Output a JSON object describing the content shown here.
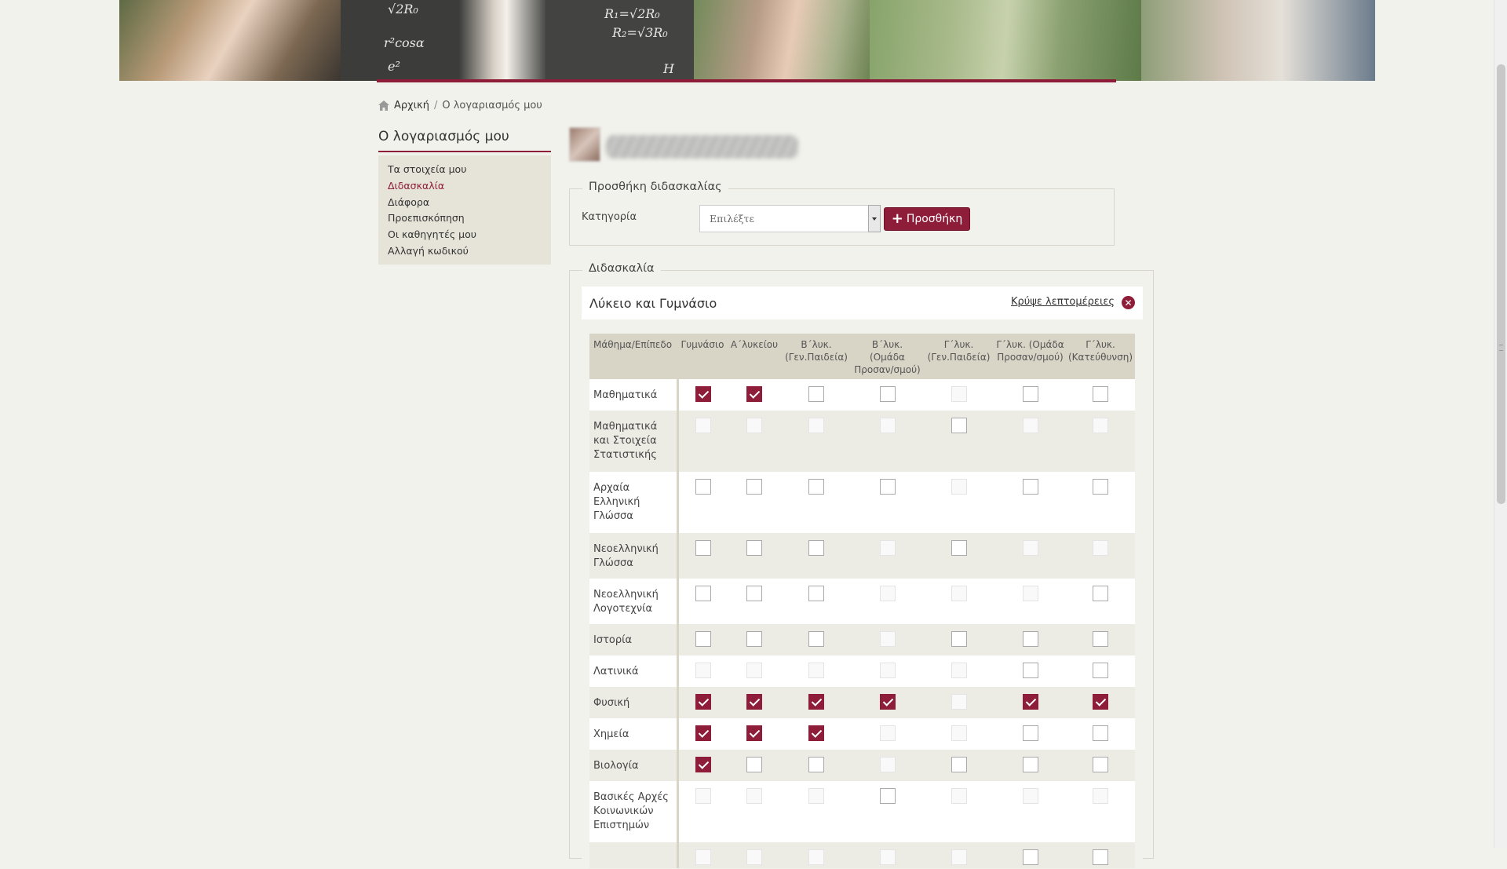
{
  "breadcrumb": {
    "home": "Αρχική",
    "current": "Ο λογαριασμός μου"
  },
  "sidebar": {
    "title": "Ο λογαριασμός μου",
    "items": [
      {
        "label": "Τα στοιχεία μου",
        "active": false
      },
      {
        "label": "Διδασκαλία",
        "active": true
      },
      {
        "label": "Διάφορα",
        "active": false
      },
      {
        "label": "Προεπισκόπηση",
        "active": false
      },
      {
        "label": "Οι καθηγητές μου",
        "active": false
      },
      {
        "label": "Αλλαγή κωδικού",
        "active": false
      }
    ]
  },
  "add_teaching": {
    "legend": "Προσθήκη διδασκαλίας",
    "category_label": "Κατηγορία",
    "select_value": "Επιλέξτε",
    "add_button": "Προσθήκη"
  },
  "teaching": {
    "legend": "Διδασκαλία",
    "card_title": "Λύκειο και Γυμνάσιο",
    "hide_details": "Κρύψε λεπτομέρειες",
    "columns": [
      "Μάθημα/Επίπεδο",
      "Γυμνάσιο",
      "Α΄λυκείου",
      "Β΄λυκ. (Γεν.Παιδεία)",
      "Β΄λυκ. (Ομάδα Προσαν/σμού)",
      "Γ΄λυκ. (Γεν.Παιδεία)",
      "Γ΄λυκ. (Ομάδα Προσαν/σμού)",
      "Γ΄λυκ. (Κατεύθυνση)"
    ],
    "rows": [
      {
        "subject": "Μαθηματικά",
        "cells": [
          "on",
          "on",
          "off",
          "off",
          "dis",
          "off",
          "off"
        ]
      },
      {
        "subject": "Μαθηματικά και Στοιχεία Στατιστικής",
        "cells": [
          "dis",
          "dis",
          "dis",
          "dis",
          "off",
          "dis",
          "dis"
        ]
      },
      {
        "subject": "Αρχαία Ελληνική Γλώσσα",
        "cells": [
          "off",
          "off",
          "off",
          "off",
          "dis",
          "off",
          "off"
        ]
      },
      {
        "subject": "Νεοελληνική Γλώσσα",
        "cells": [
          "off",
          "off",
          "off",
          "dis",
          "off",
          "dis",
          "dis"
        ]
      },
      {
        "subject": "Νεοελληνική Λογοτεχνία",
        "cells": [
          "off",
          "off",
          "off",
          "dis",
          "dis",
          "dis",
          "off"
        ]
      },
      {
        "subject": "Ιστορία",
        "cells": [
          "off",
          "off",
          "off",
          "dis",
          "off",
          "off",
          "off"
        ]
      },
      {
        "subject": "Λατινικά",
        "cells": [
          "dis",
          "dis",
          "dis",
          "dis",
          "dis",
          "off",
          "off"
        ]
      },
      {
        "subject": "Φυσική",
        "cells": [
          "on",
          "on",
          "on",
          "on",
          "dis",
          "on",
          "on"
        ]
      },
      {
        "subject": "Χημεία",
        "cells": [
          "on",
          "on",
          "on",
          "dis",
          "dis",
          "off",
          "off"
        ]
      },
      {
        "subject": "Βιολογία",
        "cells": [
          "on",
          "off",
          "off",
          "dis",
          "off",
          "off",
          "off"
        ]
      },
      {
        "subject": "Βασικές Αρχές Κοινωνικών Επιστημών",
        "cells": [
          "dis",
          "dis",
          "dis",
          "off",
          "dis",
          "dis",
          "dis"
        ]
      },
      {
        "subject": "",
        "cells": [
          "dis",
          "dis",
          "dis",
          "dis",
          "dis",
          "off",
          "off"
        ]
      }
    ]
  }
}
